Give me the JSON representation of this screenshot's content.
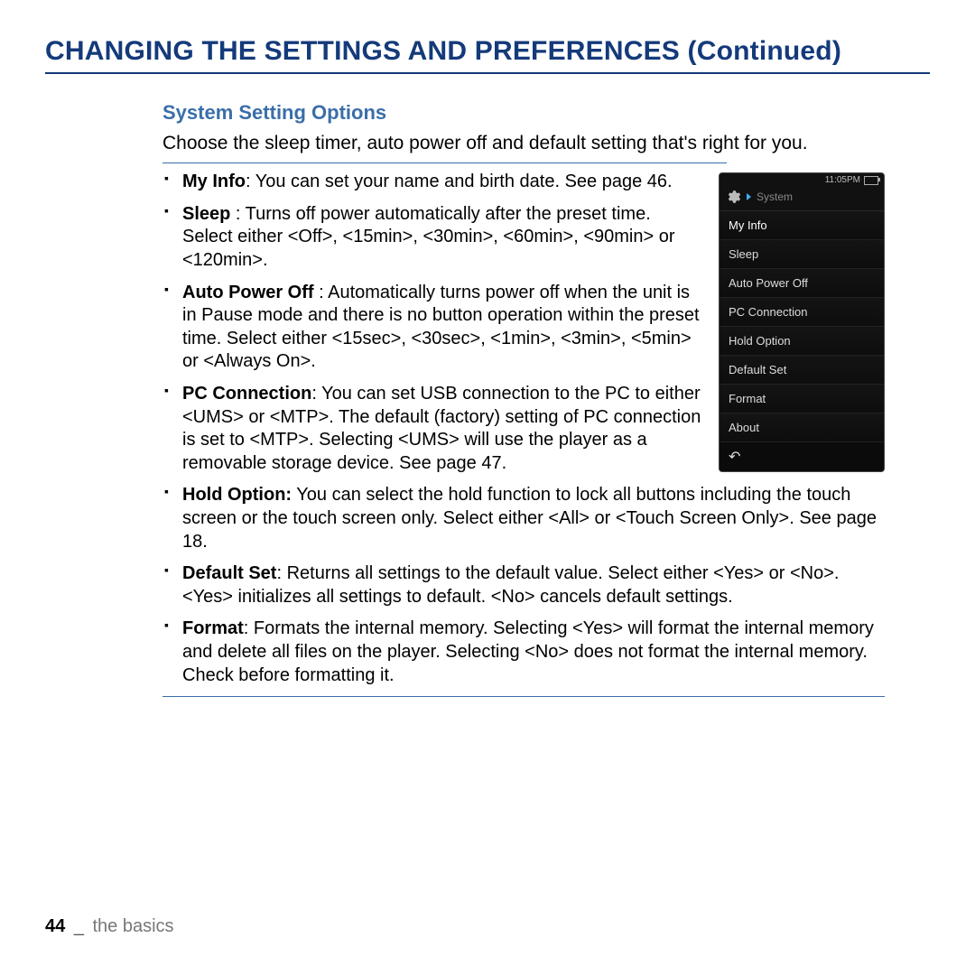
{
  "title": "CHANGING THE SETTINGS AND PREFERENCES (Continued)",
  "subhead": "System Setting Options",
  "intro": "Choose the sleep timer, auto power off and default setting that's right for you.",
  "bullets_top": [
    {
      "b": "My Info",
      "t": ": You can set your name and birth date. See page 46."
    },
    {
      "b": "Sleep",
      "t": " : Turns off power automatically after the preset time. Select either <Off>, <15min>, <30min>, <60min>, <90min> or <120min>."
    },
    {
      "b": "Auto Power Off",
      "t": " : Automatically turns power off when the unit is in Pause mode and there is no button operation within the preset time. Select either <15sec>, <30sec>, <1min>, <3min>, <5min> or <Always On>."
    },
    {
      "b": "PC Connection",
      "t": ": You can set USB connection to the PC to either <UMS> or <MTP>. The default (factory) setting of PC connection is set to <MTP>. Selecting <UMS> will use the player as a removable storage device. See page 47."
    }
  ],
  "bullets_full": [
    {
      "b": "Hold Option:",
      "t": " You can select the hold function to lock all buttons including the touch screen or the touch screen only. Select either <All> or <Touch Screen Only>. See page 18."
    },
    {
      "b": "Default Set",
      "t": ": Returns all settings to the default value. Select either <Yes> or <No>. <Yes> initializes all settings to default. <No> cancels default settings."
    },
    {
      "b": "Format",
      "t": ": Formats the internal memory. Selecting <Yes> will format the internal memory and delete all files on the player. Selecting <No> does not format the internal memory. Check before formatting it."
    }
  ],
  "device": {
    "time": "11:05PM",
    "title": "System",
    "items": [
      "My Info",
      "Sleep",
      "Auto Power Off",
      "PC Connection",
      "Hold Option",
      "Default Set",
      "Format",
      "About"
    ]
  },
  "footer": {
    "page": "44",
    "section": "the basics"
  }
}
